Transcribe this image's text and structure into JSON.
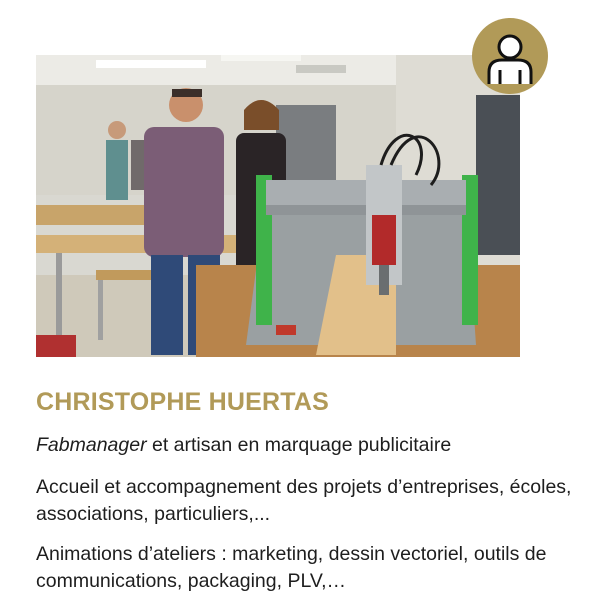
{
  "profile": {
    "name": "CHRISTOPHE HUERTAS",
    "role_emphasis": "Fabmanager",
    "role_rest": " et artisan en marquage publicitaire",
    "description_1": "Accueil et accompagnement des projets d’entreprises, écoles, associations, particuliers,...",
    "description_2": "Animations d’ateliers : marketing, dessin vectoriel, outils de communications, packaging, PLV,…"
  },
  "colors": {
    "accent": "#b19a58",
    "text": "#1e1e1e"
  },
  "icons": {
    "badge": "person-icon"
  }
}
